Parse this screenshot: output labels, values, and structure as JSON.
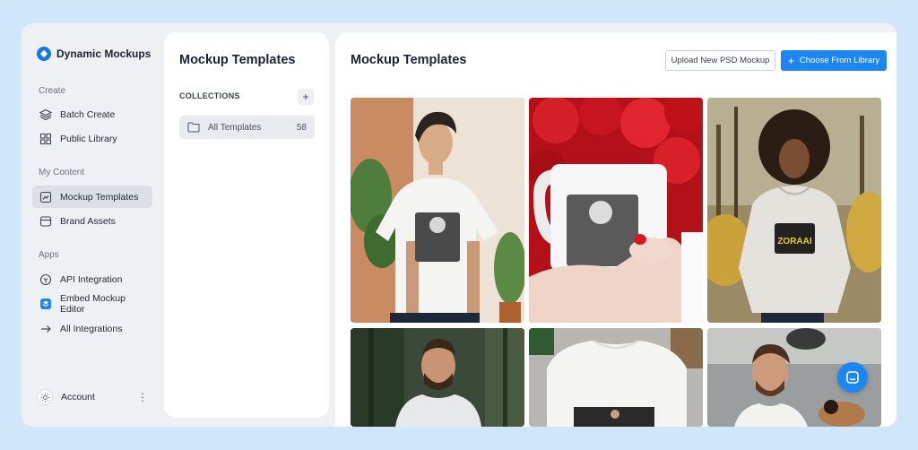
{
  "brand": {
    "name": "Dynamic Mockups"
  },
  "sidebar": {
    "sections": [
      {
        "label": "Create"
      },
      {
        "label": "My Content"
      },
      {
        "label": "Apps"
      }
    ],
    "items": [
      {
        "label": "Batch Create",
        "icon": "layers-icon"
      },
      {
        "label": "Public Library",
        "icon": "grid-icon"
      },
      {
        "label": "Mockup Templates",
        "icon": "template-icon",
        "active": true
      },
      {
        "label": "Brand Assets",
        "icon": "box-icon"
      },
      {
        "label": "API Integration",
        "icon": "api-icon"
      },
      {
        "label": "Embed Mockup Editor",
        "icon": "embed-icon"
      },
      {
        "label": "All Integrations",
        "icon": "arrow-right-icon"
      }
    ],
    "account": {
      "label": "Account"
    }
  },
  "collections": {
    "title": "Mockup Templates",
    "header": "COLLECTIONS",
    "add_symbol": "+",
    "folders": [
      {
        "label": "All Templates",
        "count": "58"
      }
    ]
  },
  "main": {
    "title": "Mockup Templates",
    "upload_button": "Upload New PSD Mockup",
    "choose_button": "Choose From Library",
    "choose_plus": "+",
    "templates": [
      {
        "kind": "tshirt-man",
        "print_label": ""
      },
      {
        "kind": "mug"
      },
      {
        "kind": "hoodie-woman",
        "print_label": "ZORAAI"
      },
      {
        "kind": "hoodie-man"
      },
      {
        "kind": "tshirt-flat"
      },
      {
        "kind": "tshirt-man-2"
      }
    ]
  },
  "colors": {
    "accent": "#1c86f2",
    "page_bg": "#cfe6fb",
    "app_bg": "#eef0f3"
  }
}
